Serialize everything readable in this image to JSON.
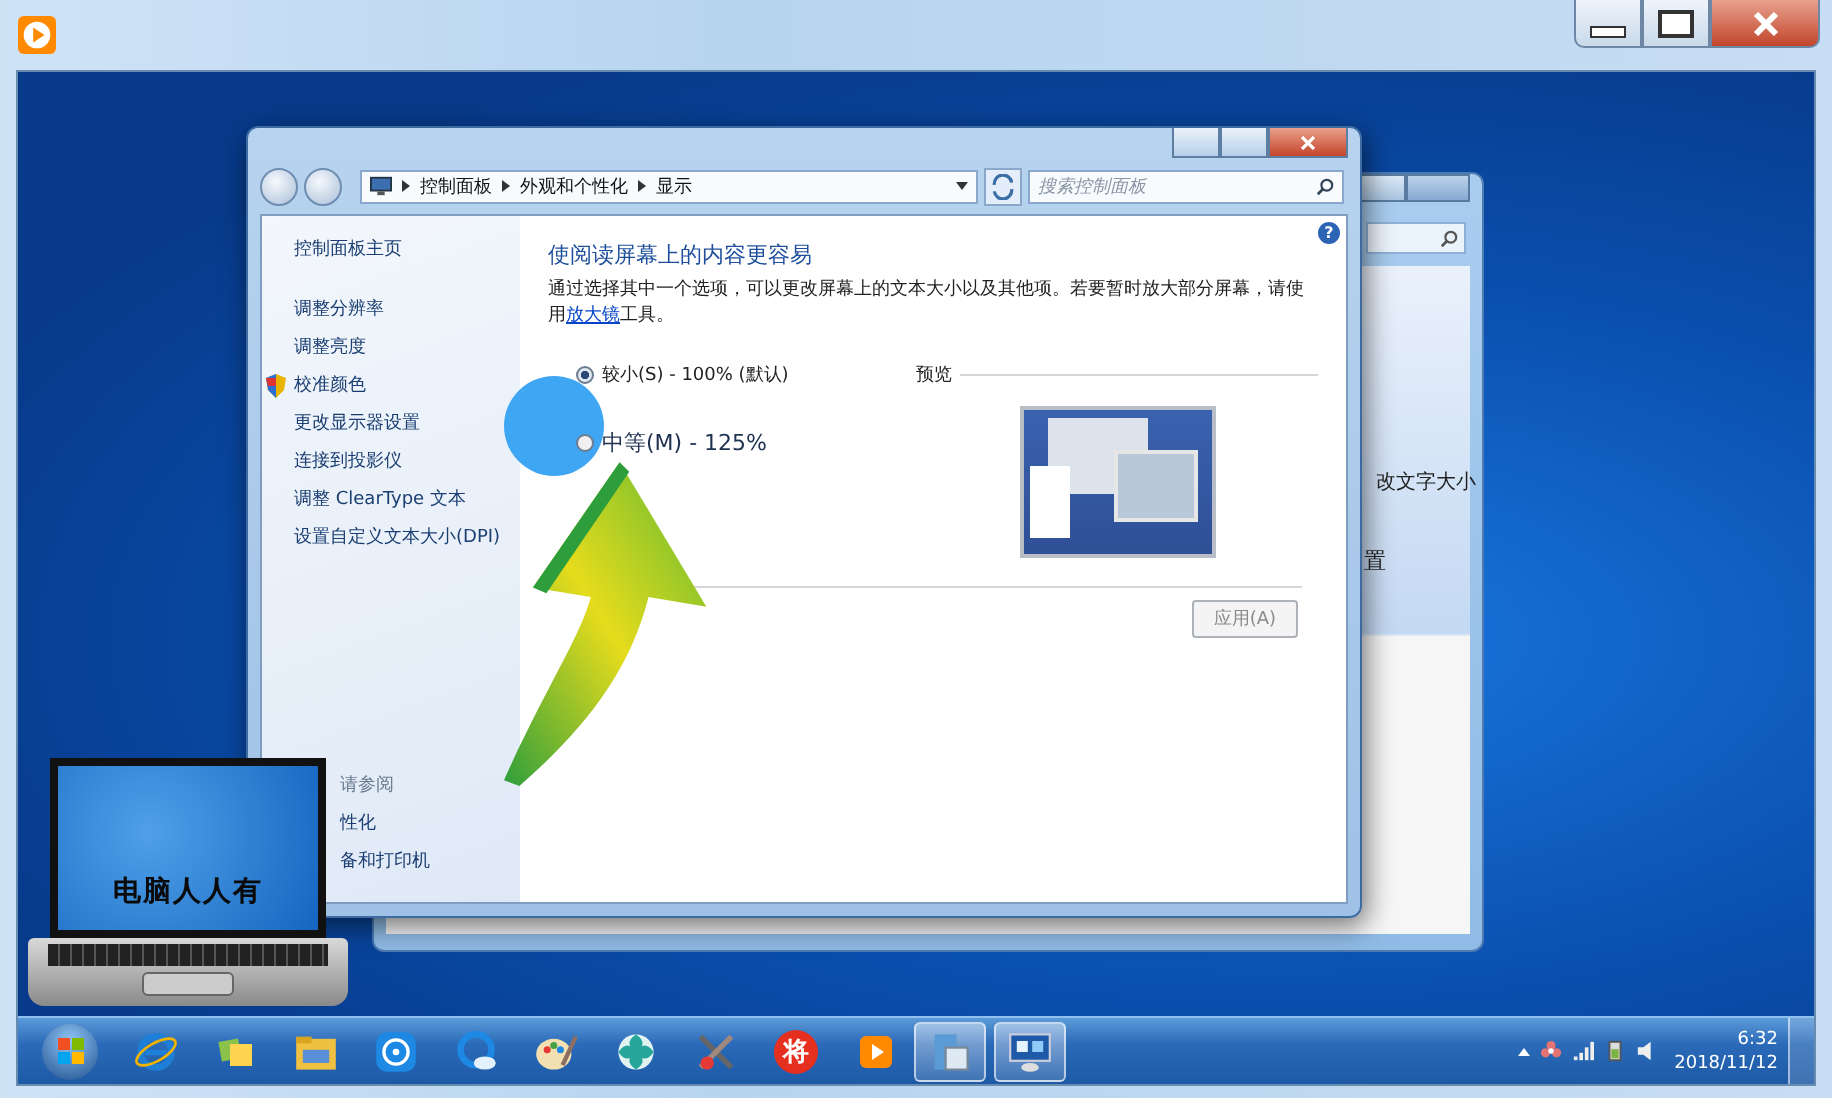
{
  "breadcrumb": [
    "控制面板",
    "外观和个性化",
    "显示"
  ],
  "search": {
    "placeholder": "搜索控制面板"
  },
  "sidebar": {
    "items": [
      {
        "label": "控制面板主页",
        "kind": "home"
      },
      {
        "label": "调整分辨率",
        "kind": "link"
      },
      {
        "label": "调整亮度",
        "kind": "link"
      },
      {
        "label": "校准颜色",
        "kind": "shield"
      },
      {
        "label": "更改显示器设置",
        "kind": "link"
      },
      {
        "label": "连接到投影仪",
        "kind": "link"
      },
      {
        "label": "调整 ClearType 文本",
        "kind": "link"
      },
      {
        "label": "设置自定义文本大小(DPI)",
        "kind": "link"
      }
    ],
    "see_also": {
      "heading": "请参阅",
      "items": [
        "性化",
        "备和打印机"
      ]
    }
  },
  "content": {
    "help": "?",
    "heading": "使阅读屏幕上的内容更容易",
    "description": "通过选择其中一个选项，可以更改屏幕上的文本大小以及其他项。若要暂时放大部分屏幕，请使用",
    "link": "放大镜",
    "description_end": "工具。"
  },
  "options": [
    {
      "label": "较小(S) - 100% (默认)",
      "selected": true
    },
    {
      "label": "中等(M) - 125%",
      "selected": false
    }
  ],
  "preview": {
    "label": "预览"
  },
  "apply_button": {
    "label": "应用(A)",
    "disabled": true
  },
  "back_window": {
    "texts": [
      "改文字大小",
      "置"
    ]
  },
  "logo": {
    "text": "电脑人人有"
  },
  "taskbar": {
    "items": [
      {
        "kind": "ie",
        "open": false
      },
      {
        "kind": "notes",
        "open": false
      },
      {
        "kind": "folder",
        "open": false
      },
      {
        "kind": "media",
        "open": false
      },
      {
        "kind": "cloud",
        "open": false
      },
      {
        "kind": "paint",
        "open": false
      },
      {
        "kind": "flower",
        "open": false
      },
      {
        "kind": "tools",
        "open": false
      },
      {
        "kind": "glyph",
        "glyph": "将",
        "open": false
      },
      {
        "kind": "player",
        "open": false
      },
      {
        "kind": "window",
        "open": true
      },
      {
        "kind": "display",
        "open": true
      }
    ],
    "clock": {
      "time": "6:32",
      "date": "2018/11/12"
    }
  }
}
